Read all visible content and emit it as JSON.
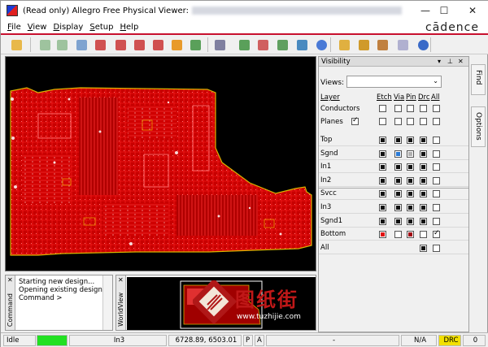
{
  "window": {
    "title_prefix": "(Read only) Allegro Free Physical Viewer:",
    "controls": {
      "minimize": "—",
      "maximize": "☐",
      "close": "✕"
    }
  },
  "menu": [
    {
      "label": "File",
      "key": "F"
    },
    {
      "label": "View",
      "key": "V"
    },
    {
      "label": "Display",
      "key": "D"
    },
    {
      "label": "Setup",
      "key": "S"
    },
    {
      "label": "Help",
      "key": "H"
    }
  ],
  "brand": "cādence",
  "toolbar": {
    "icons": [
      "open-icon",
      "grid-view-icon",
      "grid-view-2-icon",
      "zoom-fit-icon",
      "zoom-in-icon",
      "zoom-out-icon",
      "zoom-previous-icon",
      "zoom-world-icon",
      "redraw-icon",
      "3d-view-icon",
      "grid-icon",
      "layers-icon",
      "color-icon",
      "shadow-icon",
      "report-icon",
      "info-icon",
      "measure-icon",
      "ruler-icon",
      "brush-icon",
      "highlight-icon",
      "help-icon"
    ]
  },
  "visibility": {
    "title": "Visibility",
    "views_label": "Views:",
    "views_value": "",
    "columns": {
      "layer": "Layer",
      "etch": "Etch",
      "via": "Via",
      "pin": "Pin",
      "drc": "Drc",
      "all": "All"
    },
    "global_rows": [
      {
        "label": "Conductors",
        "states": [
          "empty",
          "empty",
          "empty",
          "empty",
          "empty"
        ]
      },
      {
        "label": "Planes",
        "states": [
          "checked",
          "empty",
          "empty",
          "empty",
          "empty"
        ]
      }
    ],
    "layers": [
      {
        "name": "Top",
        "etch": "black",
        "via": "black",
        "pin": "black",
        "drc": "black",
        "all": "empty"
      },
      {
        "name": "Sgnd",
        "etch": "black",
        "via": "blue",
        "pin": "gray",
        "drc": "black",
        "all": "empty"
      },
      {
        "name": "In1",
        "etch": "black",
        "via": "black",
        "pin": "black",
        "drc": "black",
        "all": "empty"
      },
      {
        "name": "In2",
        "etch": "black",
        "via": "black",
        "pin": "black",
        "drc": "black",
        "all": "empty"
      },
      {
        "name": "Svcc",
        "etch": "black",
        "via": "black",
        "pin": "black",
        "drc": "black",
        "all": "empty"
      },
      {
        "name": "In3",
        "etch": "black",
        "via": "black",
        "pin": "black",
        "drc": "black",
        "all": "empty"
      },
      {
        "name": "Sgnd1",
        "etch": "black",
        "via": "black",
        "pin": "black",
        "drc": "black",
        "all": "empty"
      },
      {
        "name": "Bottom",
        "etch": "red",
        "via": "empty",
        "pin": "dred",
        "drc": "empty",
        "all": "checked"
      },
      {
        "name": "All",
        "etch": "",
        "via": "",
        "pin": "",
        "drc": "black",
        "all": "empty"
      }
    ]
  },
  "side_tabs": [
    "Find",
    "Options"
  ],
  "command": {
    "label": "Command",
    "lines": [
      "Starting new design...",
      "Opening existing design...",
      "Command >"
    ]
  },
  "worldview": {
    "label": "WorldView"
  },
  "watermark": {
    "cn": "图纸街",
    "url": "www.tuzhijie.com"
  },
  "status": {
    "state": "Idle",
    "indicator_color": "#22e022",
    "layer": "In3",
    "coords": "6728.89, 6503.01",
    "p": "P",
    "a": "A",
    "separator": "-",
    "na": "N/A",
    "drc": "DRC",
    "drc_color": "#f2e000",
    "count": "0"
  }
}
